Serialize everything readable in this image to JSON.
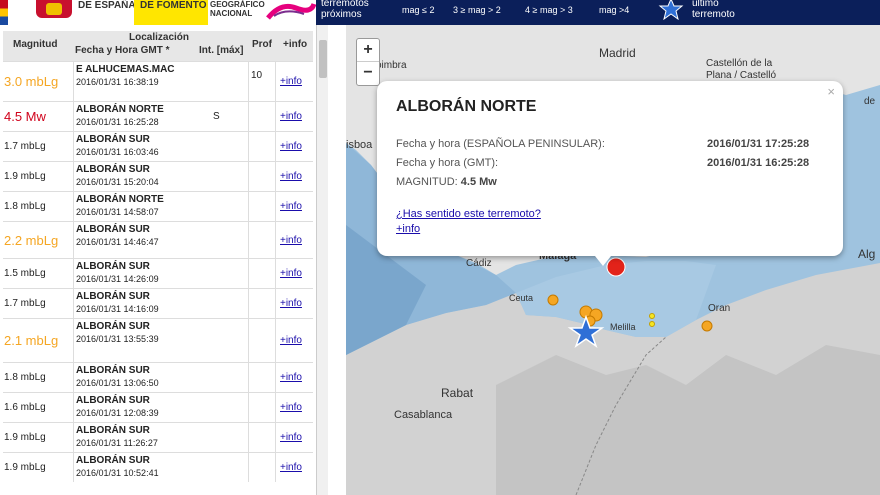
{
  "header": {
    "es_label": "DE ESPAÑA",
    "fomento_label": "DE FOMENTO",
    "ign_label1": "GEOGRÁFICO",
    "ign_label2": "NACIONAL",
    "near_label1": "terremotos",
    "near_label2": "próximos",
    "mag_filters": [
      "mag ≤ 2",
      "3 ≥ mag > 2",
      "4 ≥ mag > 3",
      "mag >4"
    ],
    "last_label1": "último",
    "last_label2": "terremoto"
  },
  "list": {
    "columns": {
      "magnitude": "Magnitud",
      "location": "Localización",
      "datetime": "Fecha y Hora GMT *",
      "intensity": "Int. [máx]",
      "depth": "Prof",
      "info": "+info"
    },
    "rows": [
      {
        "mag": "3.0 mbLg",
        "color": "#f5a623",
        "place": "E ALHUCEMAS.MAC",
        "date": "2016/01/31 16:38:19",
        "int": "",
        "prof": "10",
        "info": "+info"
      },
      {
        "mag": "4.5 Mw",
        "color": "#d0021b",
        "place": "ALBORÁN NORTE",
        "date": "2016/01/31 16:25:28",
        "int": "S",
        "prof": "",
        "info": "+info"
      },
      {
        "mag": "1.7 mbLg",
        "color": "#222222",
        "place": "ALBORÁN SUR",
        "date": "2016/01/31 16:03:46",
        "int": "",
        "prof": "",
        "info": "+info"
      },
      {
        "mag": "1.9 mbLg",
        "color": "#222222",
        "place": "ALBORÁN SUR",
        "date": "2016/01/31 15:20:04",
        "int": "",
        "prof": "",
        "info": "+info"
      },
      {
        "mag": "1.8 mbLg",
        "color": "#222222",
        "place": "ALBORÁN NORTE",
        "date": "2016/01/31 14:58:07",
        "int": "",
        "prof": "",
        "info": "+info"
      },
      {
        "mag": "2.2 mbLg",
        "color": "#f5a623",
        "place": "ALBORÁN SUR",
        "date": "2016/01/31 14:46:47",
        "int": "",
        "prof": "",
        "info": "+info"
      },
      {
        "mag": "1.5 mbLg",
        "color": "#222222",
        "place": "ALBORÁN SUR",
        "date": "2016/01/31 14:26:09",
        "int": "",
        "prof": "",
        "info": "+info"
      },
      {
        "mag": "1.7 mbLg",
        "color": "#222222",
        "place": "ALBORÁN SUR",
        "date": "2016/01/31 14:16:09",
        "int": "",
        "prof": "",
        "info": "+info"
      },
      {
        "mag": "2.1 mbLg",
        "color": "#f5a623",
        "place": "ALBORÁN SUR",
        "date": "2016/01/31 13:55:39",
        "int": "",
        "prof": "",
        "info": "+info"
      },
      {
        "mag": "1.8 mbLg",
        "color": "#222222",
        "place": "ALBORÁN SUR",
        "date": "2016/01/31 13:06:50",
        "int": "",
        "prof": "",
        "info": "+info"
      },
      {
        "mag": "1.6 mbLg",
        "color": "#222222",
        "place": "ALBORÁN SUR",
        "date": "2016/01/31 12:08:39",
        "int": "",
        "prof": "",
        "info": "+info"
      },
      {
        "mag": "1.9 mbLg",
        "color": "#222222",
        "place": "ALBORÁN SUR",
        "date": "2016/01/31 11:26:27",
        "int": "",
        "prof": "",
        "info": "+info"
      },
      {
        "mag": "1.9 mbLg",
        "color": "#222222",
        "place": "ALBORÁN SUR",
        "date": "2016/01/31 10:52:41",
        "int": "",
        "prof": "",
        "info": "+info"
      }
    ]
  },
  "map": {
    "labels": {
      "madrid": "Madrid",
      "coimbra": "oimbra",
      "castellon": "Castellón de la",
      "castellon2": "Plana / Castelló",
      "lisboa": "isboa",
      "cadiz": "Cádiz",
      "malaga": "Málaga",
      "ceuta": "Ceuta",
      "melilla": "Melilla",
      "oran": "Oran",
      "rabat": "Rabat",
      "casablanca": "Casablanca",
      "algiers": "Alg",
      "edge_de": "de"
    },
    "zoom_in": "+",
    "zoom_out": "−"
  },
  "popup": {
    "title": "ALBORÁN NORTE",
    "label_local": "Fecha y hora (ESPAÑOLA PENINSULAR):",
    "value_local": "2016/01/31 17:25:28",
    "label_gmt": "Fecha y hora (GMT):",
    "value_gmt": "2016/01/31 16:25:28",
    "magnitude_label": "MAGNITUD:",
    "magnitude_value": "4.5 Mw",
    "felt_link": "¿Has sentido este terremoto?",
    "info_link": "+info",
    "close": "×"
  },
  "colors": {
    "header_dark": "#0b1f5a",
    "fomento_yellow": "#ffe600",
    "mag_high": "#d0021b",
    "mag_mid": "#f5a623",
    "link": "#1a0dab"
  }
}
